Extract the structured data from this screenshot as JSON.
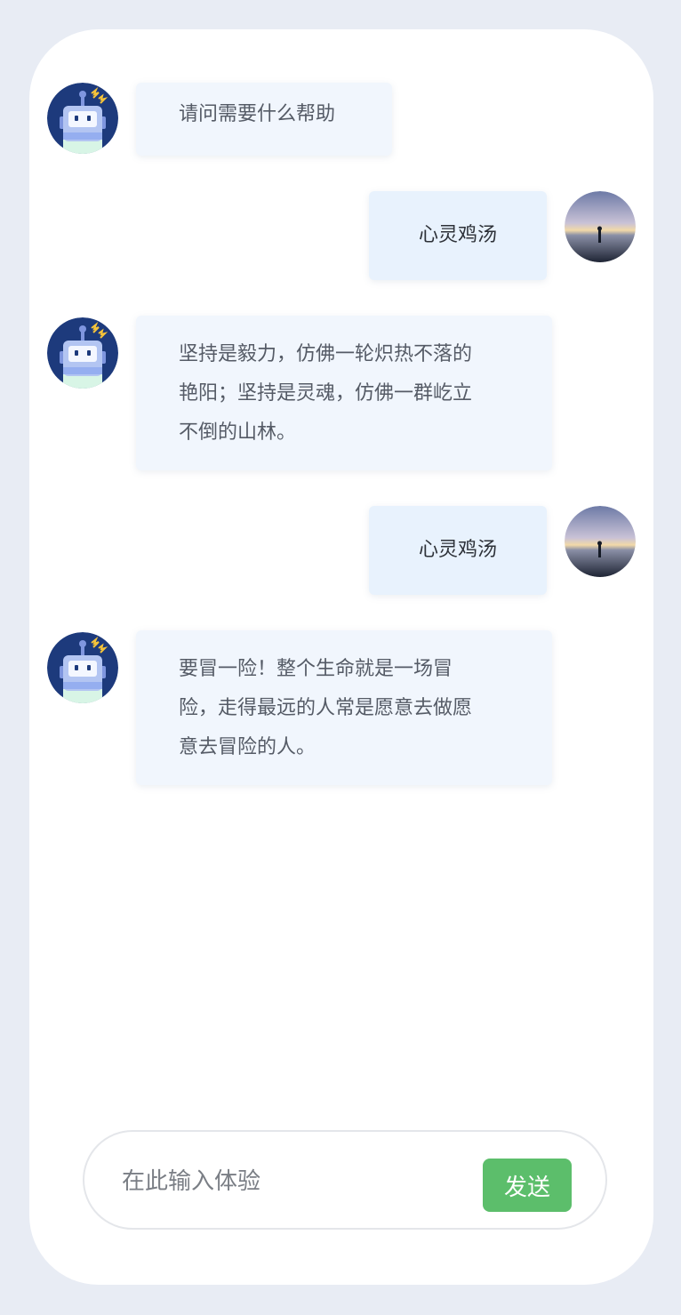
{
  "messages": [
    {
      "role": "bot",
      "text": "请问需要什么帮助"
    },
    {
      "role": "user",
      "text": "心灵鸡汤"
    },
    {
      "role": "bot",
      "text": "坚持是毅力，仿佛一轮炽热不落的\n艳阳；坚持是灵魂，仿佛一群屹立\n不倒的山林。"
    },
    {
      "role": "user",
      "text": "心灵鸡汤"
    },
    {
      "role": "bot",
      "text": "要冒一险！整个生命就是一场冒\n险，走得最远的人常是愿意去做愿\n意去冒险的人。"
    }
  ],
  "input": {
    "placeholder": "在此输入体验",
    "value": ""
  },
  "send_button": {
    "label": "发送"
  },
  "colors": {
    "background": "#e8ecf4",
    "bot_bubble": "#f1f6fd",
    "user_bubble": "#e8f2fd",
    "send": "#5cbe6b"
  },
  "icons": {
    "bot_avatar": "robot-avatar-icon",
    "user_avatar": "user-photo-avatar"
  }
}
